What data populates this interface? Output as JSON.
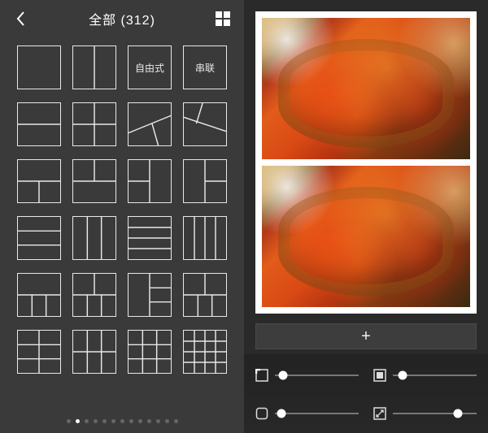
{
  "header": {
    "title": "全部 (312)"
  },
  "layout_text_tiles": {
    "freestyle": "自由式",
    "serial": "串联"
  },
  "pagination": {
    "total_dots": 13,
    "active_index": 1
  },
  "add_button": {
    "label": "+"
  },
  "sliders": {
    "outer_border": {
      "value_pct": 10
    },
    "inner_border": {
      "value_pct": 12
    },
    "corner_radius": {
      "value_pct": 8
    },
    "aspect_ratio": {
      "value_pct": 78
    }
  },
  "collage": {
    "slots": 2,
    "photo_description": "tomato tart / pizza with cherry tomatoes"
  }
}
